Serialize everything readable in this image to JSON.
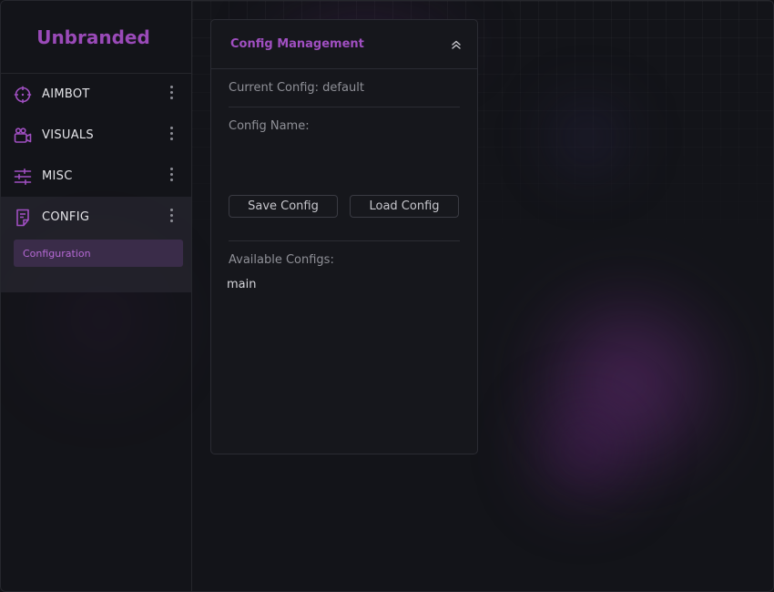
{
  "brand": {
    "name": "Unbranded",
    "color": "#9a4ab8"
  },
  "sidebar": {
    "items": [
      {
        "label": "AIMBOT",
        "icon": "crosshair-icon"
      },
      {
        "label": "VISUALS",
        "icon": "camera-icon"
      },
      {
        "label": "MISC",
        "icon": "sliders-icon"
      },
      {
        "label": "CONFIG",
        "icon": "document-icon",
        "active": true
      }
    ],
    "sub_items": [
      {
        "label": "Configuration",
        "active": true
      }
    ]
  },
  "panel": {
    "title": "Config Management",
    "current_config_label": "Current Config: default",
    "config_name_label": "Config Name:",
    "config_name_value": "",
    "save_label": "Save Config",
    "load_label": "Load Config",
    "available_label": "Available Configs:",
    "configs": [
      "main"
    ]
  },
  "colors": {
    "accent": "#a04fc1",
    "accent_bg": "#3a2c49",
    "background": "#131419"
  }
}
